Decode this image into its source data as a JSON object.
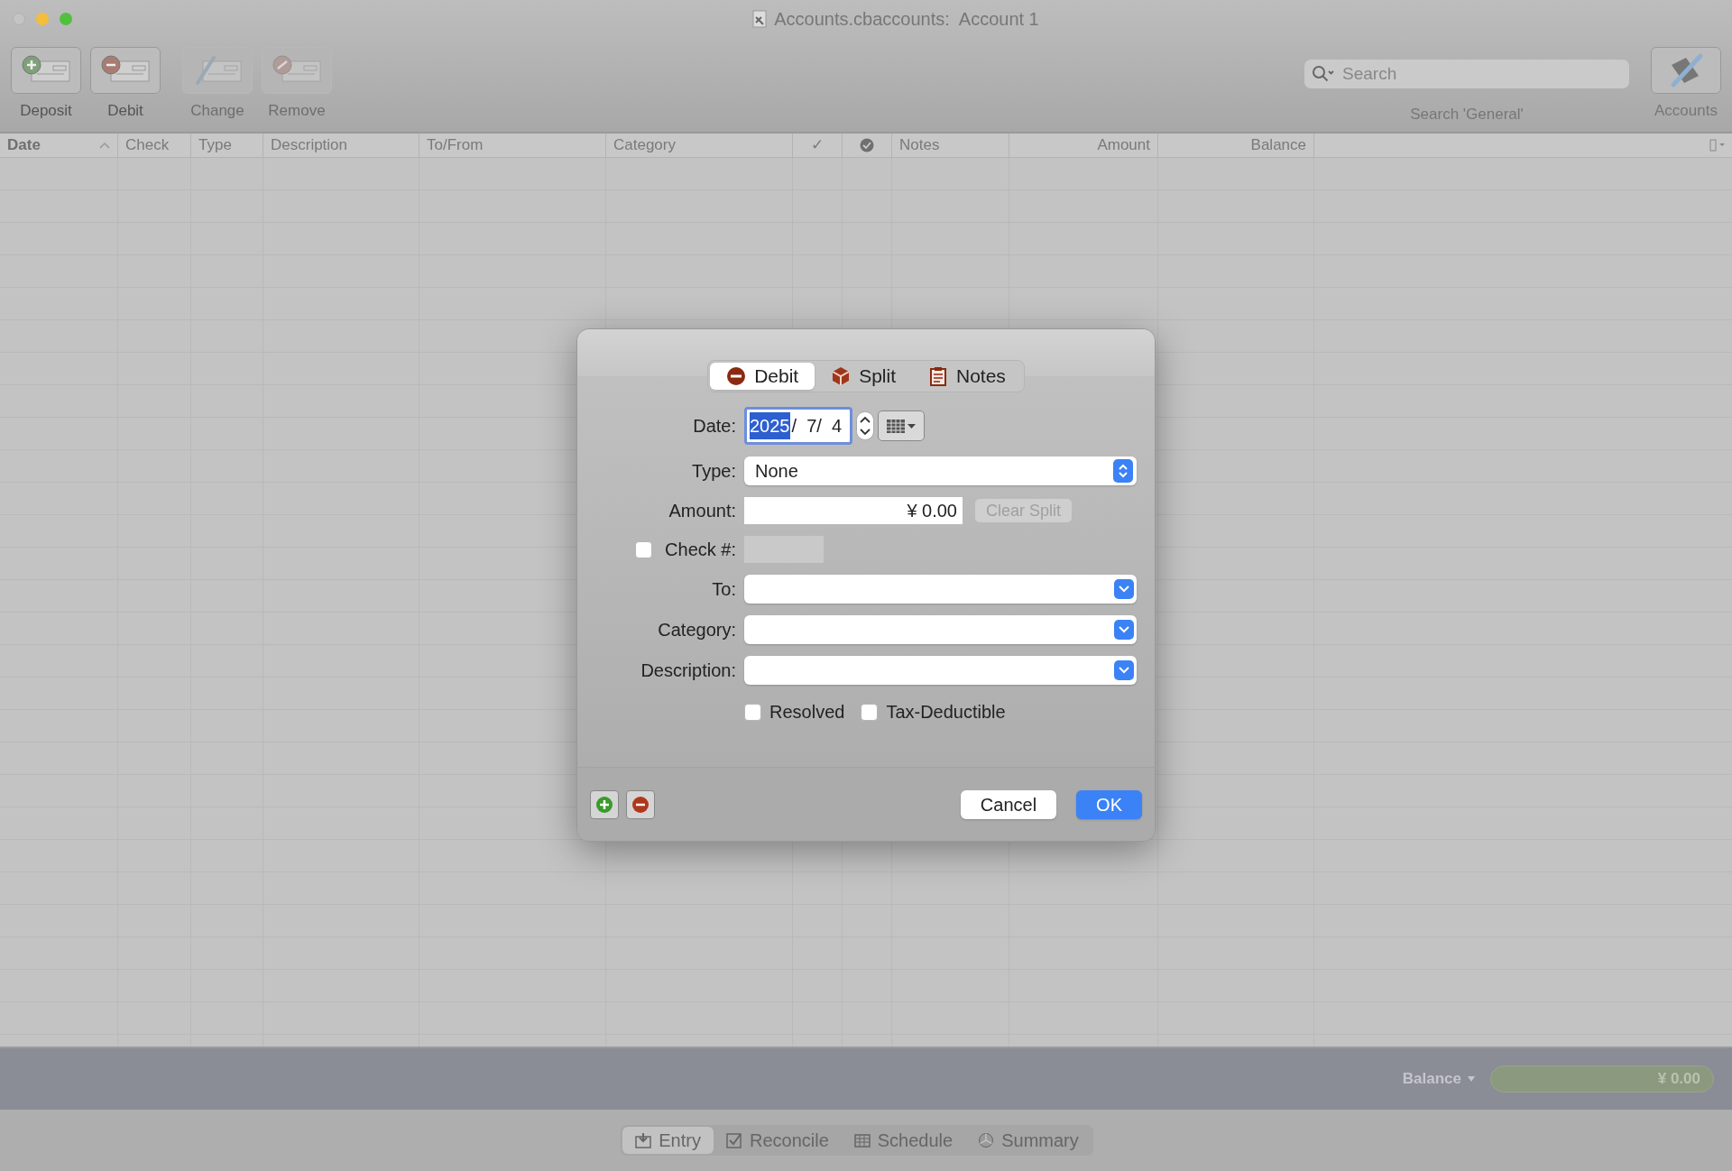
{
  "window": {
    "title": "Accounts.cbaccounts:  Account 1"
  },
  "toolbar": {
    "items": [
      {
        "kind": "deposit",
        "label": "Deposit",
        "disabled": false
      },
      {
        "kind": "debit",
        "label": "Debit",
        "disabled": false
      },
      {
        "kind": "change",
        "label": "Change",
        "disabled": true
      },
      {
        "kind": "remove",
        "label": "Remove",
        "disabled": true
      }
    ],
    "search": {
      "placeholder": "Search",
      "label": "Search 'General'"
    },
    "accounts_button": {
      "label": "Accounts"
    }
  },
  "table": {
    "columns": [
      {
        "label": "Date",
        "sorted": true
      },
      {
        "label": "Check",
        "sorted": false
      },
      {
        "label": "Type",
        "sorted": false
      },
      {
        "label": "Description",
        "sorted": false
      },
      {
        "label": "To/From",
        "sorted": false
      },
      {
        "label": "Category",
        "sorted": false
      },
      {
        "label": "✓",
        "sorted": false
      },
      {
        "kind": "icon",
        "sorted": false
      },
      {
        "label": "Notes",
        "sorted": false
      },
      {
        "label": "Amount",
        "sorted": false
      },
      {
        "label": "Balance",
        "sorted": false
      }
    ]
  },
  "status_bar": {
    "balance_label": "Balance",
    "balance_value": "¥ 0.00"
  },
  "view_tabs": [
    {
      "kind": "entry",
      "label": "Entry",
      "selected": true
    },
    {
      "kind": "reconcile",
      "label": "Reconcile",
      "selected": false
    },
    {
      "kind": "schedule",
      "label": "Schedule",
      "selected": false
    },
    {
      "kind": "summary",
      "label": "Summary",
      "selected": false
    }
  ],
  "dialog": {
    "tabs": [
      {
        "kind": "debit",
        "label": "Debit",
        "selected": true
      },
      {
        "kind": "split",
        "label": "Split",
        "selected": false
      },
      {
        "kind": "notes",
        "label": "Notes",
        "selected": false
      }
    ],
    "date": {
      "label": "Date:",
      "segments": [
        {
          "text": "2025",
          "selected": true
        },
        {
          "text": "/  7/  4",
          "selected": false
        }
      ]
    },
    "type": {
      "label": "Type:",
      "value": "None"
    },
    "amount": {
      "label": "Amount:",
      "value": "¥ 0.00",
      "clear_split": {
        "label": "Clear Split",
        "disabled": true
      }
    },
    "check": {
      "label": "Check #:",
      "checked": false
    },
    "to": {
      "label": "To:"
    },
    "category": {
      "label": "Category:"
    },
    "description": {
      "label": "Description:"
    },
    "options": [
      {
        "label": "Resolved",
        "checked": false
      },
      {
        "label": "Tax-Deductible",
        "checked": false
      }
    ],
    "buttons": [
      {
        "label": "Cancel",
        "default": false
      },
      {
        "label": "OK",
        "default": true
      }
    ]
  }
}
